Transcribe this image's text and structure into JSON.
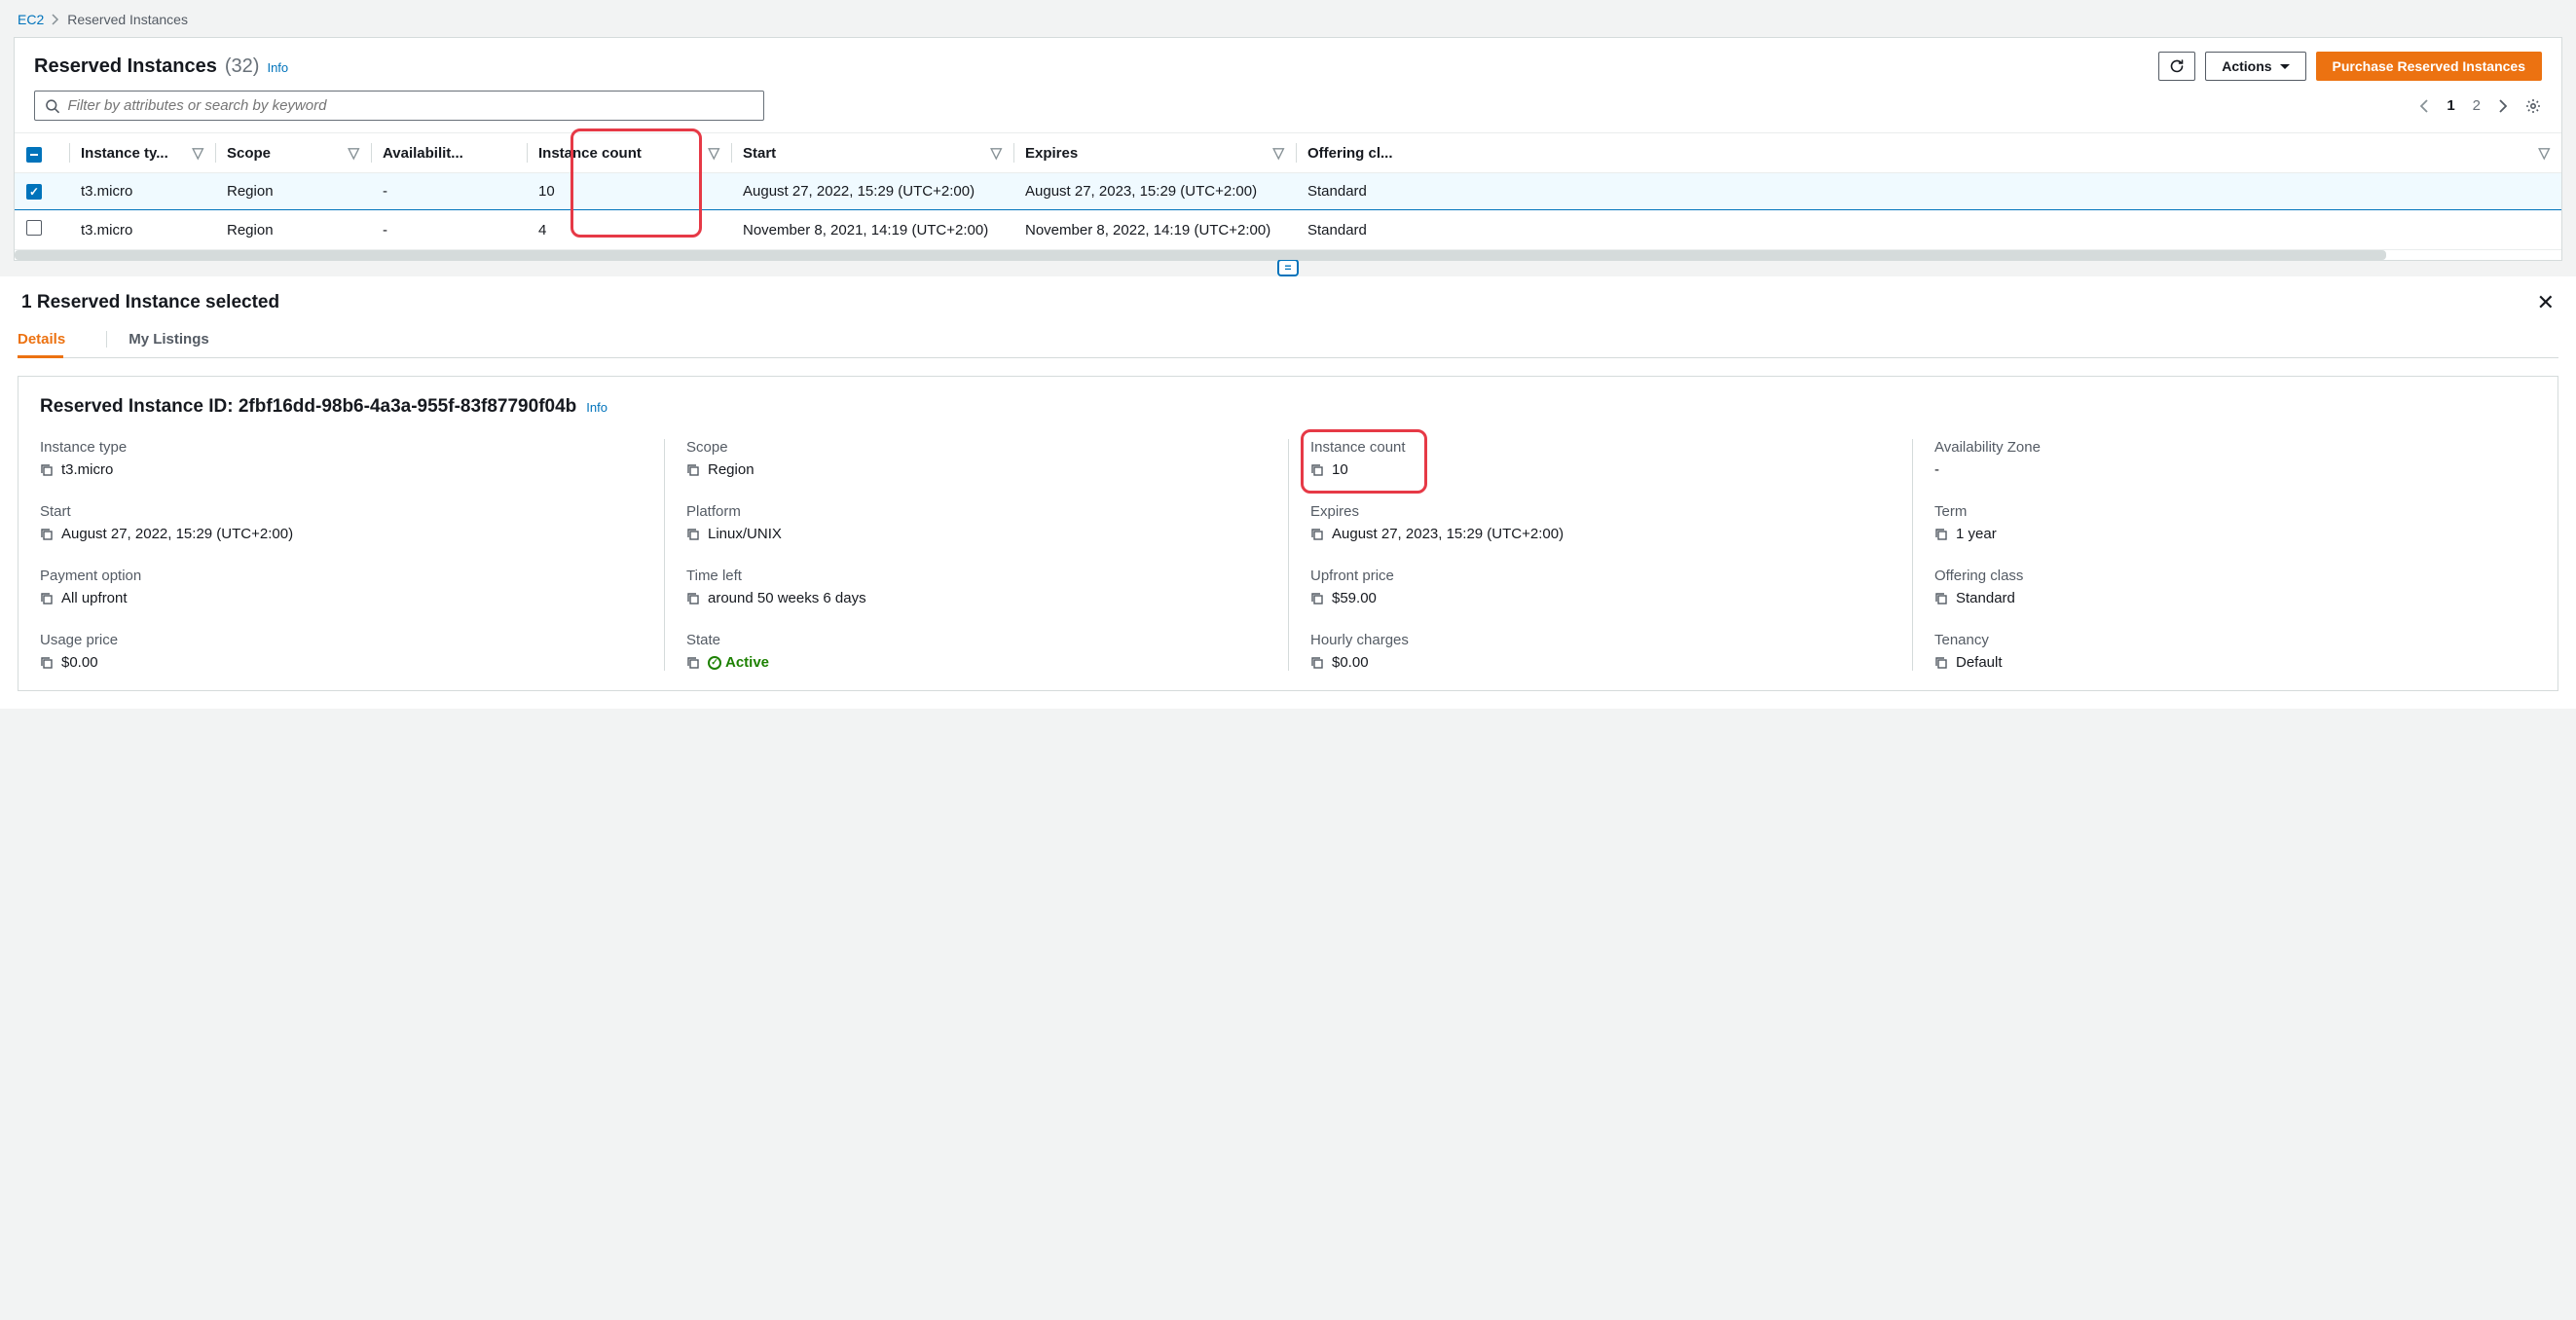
{
  "breadcrumb": {
    "root": "EC2",
    "current": "Reserved Instances"
  },
  "header": {
    "title": "Reserved Instances",
    "count": "(32)",
    "info": "Info",
    "actions_label": "Actions",
    "purchase_label": "Purchase Reserved Instances"
  },
  "search": {
    "placeholder": "Filter by attributes or search by keyword"
  },
  "pager": {
    "pages": [
      "1",
      "2"
    ],
    "active": 0
  },
  "columns": {
    "instance_type": "Instance ty...",
    "scope": "Scope",
    "az": "Availabilit...",
    "count": "Instance count",
    "start": "Start",
    "expires": "Expires",
    "offering": "Offering cl..."
  },
  "rows": [
    {
      "selected": true,
      "instance_type": "t3.micro",
      "scope": "Region",
      "az": "-",
      "count": "10",
      "start": "August 27, 2022, 15:29 (UTC+2:00)",
      "expires": "August 27, 2023, 15:29 (UTC+2:00)",
      "offering": "Standard"
    },
    {
      "selected": false,
      "instance_type": "t3.micro",
      "scope": "Region",
      "az": "-",
      "count": "4",
      "start": "November 8, 2021, 14:19 (UTC+2:00)",
      "expires": "November 8, 2022, 14:19 (UTC+2:00)",
      "offering": "Standard"
    }
  ],
  "selection_title": "1 Reserved Instance selected",
  "tabs": {
    "details": "Details",
    "listings": "My Listings"
  },
  "detail": {
    "id_label": "Reserved Instance ID:",
    "id_value": "2fbf16dd-98b6-4a3a-955f-83f87790f04b",
    "info": "Info",
    "fields": {
      "instance_type": {
        "label": "Instance type",
        "value": "t3.micro"
      },
      "start": {
        "label": "Start",
        "value": "August 27, 2022, 15:29 (UTC+2:00)"
      },
      "payment_option": {
        "label": "Payment option",
        "value": "All upfront"
      },
      "usage_price": {
        "label": "Usage price",
        "value": "$0.00"
      },
      "scope": {
        "label": "Scope",
        "value": "Region"
      },
      "platform": {
        "label": "Platform",
        "value": "Linux/UNIX"
      },
      "time_left": {
        "label": "Time left",
        "value": "around 50 weeks 6 days"
      },
      "state": {
        "label": "State",
        "value": "Active"
      },
      "instance_count": {
        "label": "Instance count",
        "value": "10"
      },
      "expires": {
        "label": "Expires",
        "value": "August 27, 2023, 15:29 (UTC+2:00)"
      },
      "upfront_price": {
        "label": "Upfront price",
        "value": "$59.00"
      },
      "hourly_charges": {
        "label": "Hourly charges",
        "value": "$0.00"
      },
      "az": {
        "label": "Availability Zone",
        "value": "-"
      },
      "term": {
        "label": "Term",
        "value": "1 year"
      },
      "offering_class": {
        "label": "Offering class",
        "value": "Standard"
      },
      "tenancy": {
        "label": "Tenancy",
        "value": "Default"
      }
    }
  }
}
